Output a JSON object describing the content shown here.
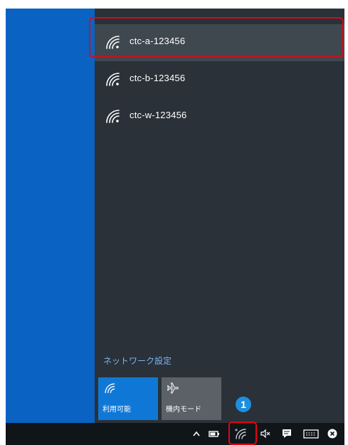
{
  "networks": [
    {
      "ssid": "ctc-a-123456",
      "highlighted": true
    },
    {
      "ssid": "ctc-b-123456",
      "highlighted": false
    },
    {
      "ssid": "ctc-w-123456",
      "highlighted": false
    }
  ],
  "network_settings_label": "ネットワーク設定",
  "tiles": {
    "wifi_label": "利用可能",
    "airplane_label": "機内モード"
  },
  "step_marker": "1",
  "colors": {
    "desktop": "#0a63c3",
    "flyout": "#2a3138",
    "accent": "#0f78d6",
    "highlight": "#e30613",
    "link": "#79b6f2"
  },
  "icons": {
    "network": "wifi-icon",
    "wifi_tile": "wifi-icon",
    "airplane_tile": "airplane-icon",
    "tray": [
      "chevron-up-icon",
      "battery-icon",
      "wifi-icon",
      "speaker-mute-icon",
      "action-center-icon",
      "keyboard-icon",
      "close-circle-icon"
    ]
  }
}
